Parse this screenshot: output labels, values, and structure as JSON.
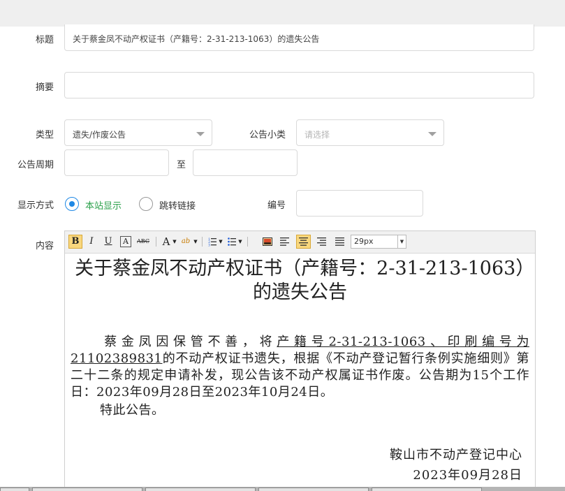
{
  "form": {
    "title_label": "标题",
    "title_value": "关于蔡金凤不动产权证书（产籍号：2-31-213-1063）的遗失公告",
    "summary_label": "摘要",
    "summary_value": "",
    "type_label": "类型",
    "type_value": "遗失/作废公告",
    "subtype_label": "公告小类",
    "subtype_placeholder": "请选择",
    "period_label": "公告周期",
    "period_to": "至",
    "period_start": "",
    "period_end": "",
    "display_label": "显示方式",
    "display_options": [
      "本站显示",
      "跳转链接"
    ],
    "display_selected": "本站显示",
    "code_label": "编号",
    "code_value": "",
    "content_label": "内容"
  },
  "editor": {
    "toolbar": {
      "bold": "B",
      "italic": "I",
      "underline": "U",
      "box": "A",
      "strike": "ABC",
      "font_color": "A",
      "highlight": "ab",
      "font_size": "29px"
    },
    "doc_title": "关于蔡金凤不动产权证书（产籍号：2-31-213-1063）的遗失公告",
    "para_before": "蔡金凤因保管不善，将",
    "para_underlined": "产籍号2-31-213-1063、印刷编号为21102389831",
    "para_after": "的不动产权证书遗失，根据《不动产登记暂行条例实施细则》第二十二条的规定申请补发，现公告该不动产权属证书作废。公告期为15个工作日：2023年09月28日至2023年10月24日。",
    "closing": "特此公告。",
    "signature": "鞍山市不动产登记中心",
    "date": "2023年09月28日"
  },
  "colors": {
    "accent": "#1e88e5",
    "selected_text": "#2aa04a",
    "active_button": "#f9d77e"
  }
}
